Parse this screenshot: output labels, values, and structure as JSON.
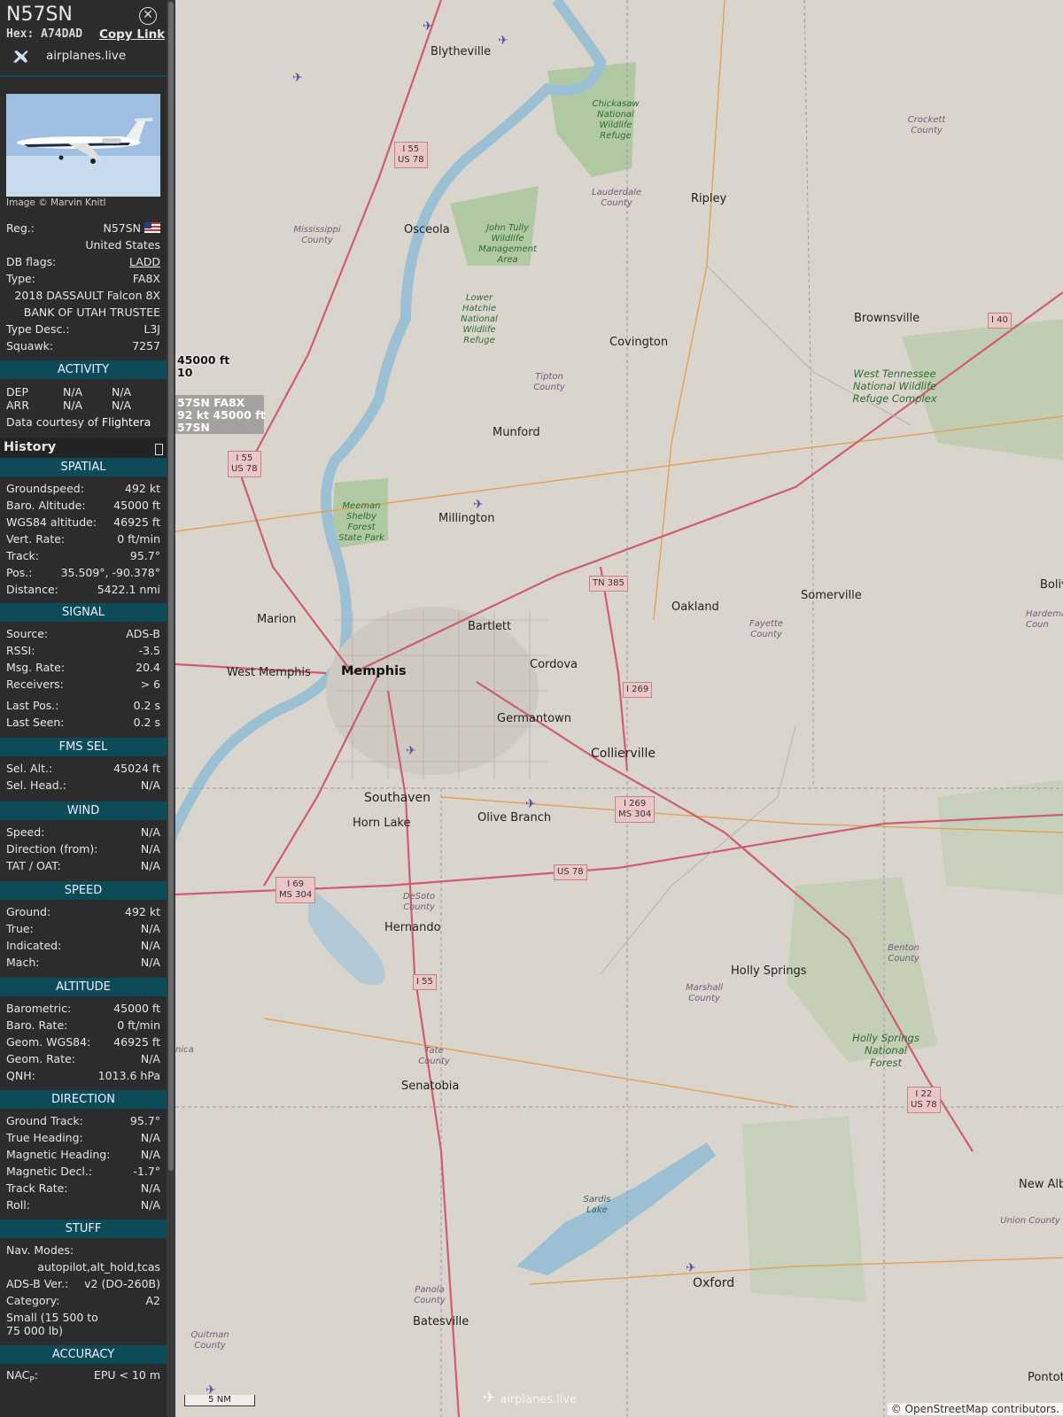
{
  "header": {
    "callsign": "N57SN",
    "hex_label": "Hex:",
    "hex": "A74DAD",
    "copy_link": "Copy Link",
    "link_text": "airplanes.live"
  },
  "photo": {
    "credit": "Image © Marvin Knitl"
  },
  "info": {
    "reg_label": "Reg.:",
    "reg": "N57SN",
    "country": "United States",
    "dbflags_label": "DB flags:",
    "dbflags": "LADD",
    "type_label": "Type:",
    "type": "FA8X",
    "model": "2018 DASSAULT Falcon 8X",
    "owner": "BANK OF UTAH TRUSTEE",
    "typedesc_label": "Type Desc.:",
    "typedesc": "L3J",
    "squawk_label": "Squawk:",
    "squawk": "7257"
  },
  "activity": {
    "title": "ACTIVITY",
    "dep": "DEP",
    "arr": "ARR",
    "na": "N/A",
    "courtesy": "Data courtesy of",
    "source": "Flightera"
  },
  "history": {
    "title": "History"
  },
  "spatial": {
    "title": "SPATIAL",
    "rows": [
      [
        "Groundspeed:",
        "492 kt"
      ],
      [
        "Baro. Altitude:",
        "45000 ft"
      ],
      [
        "WGS84 altitude:",
        "46925 ft"
      ],
      [
        "Vert. Rate:",
        "0 ft/min"
      ],
      [
        "Track:",
        "95.7°"
      ],
      [
        "Pos.:",
        "35.509°, -90.378°"
      ],
      [
        "Distance:",
        "5422.1 nmi"
      ]
    ]
  },
  "signal": {
    "title": "SIGNAL",
    "rows": [
      [
        "Source:",
        "ADS-B"
      ],
      [
        "RSSI:",
        "-3.5"
      ],
      [
        "Msg. Rate:",
        "20.4"
      ],
      [
        "Receivers:",
        "> 6"
      ],
      [
        "Last Pos.:",
        "0.2 s"
      ],
      [
        "Last Seen:",
        "0.2 s"
      ]
    ]
  },
  "fms": {
    "title": "FMS SEL",
    "rows": [
      [
        "Sel. Alt.:",
        "45024 ft"
      ],
      [
        "Sel. Head.:",
        "N/A"
      ]
    ]
  },
  "wind": {
    "title": "WIND",
    "rows": [
      [
        "Speed:",
        "N/A"
      ],
      [
        "Direction (from):",
        "N/A"
      ],
      [
        "TAT / OAT:",
        "N/A"
      ]
    ]
  },
  "speed": {
    "title": "SPEED",
    "rows": [
      [
        "Ground:",
        "492 kt"
      ],
      [
        "True:",
        "N/A"
      ],
      [
        "Indicated:",
        "N/A"
      ],
      [
        "Mach:",
        "N/A"
      ]
    ]
  },
  "altitude": {
    "title": "ALTITUDE",
    "rows": [
      [
        "Barometric:",
        "45000 ft"
      ],
      [
        "Baro. Rate:",
        "0 ft/min"
      ],
      [
        "Geom. WGS84:",
        "46925 ft"
      ],
      [
        "Geom. Rate:",
        "N/A"
      ],
      [
        "QNH:",
        "1013.6 hPa"
      ]
    ]
  },
  "direction": {
    "title": "DIRECTION",
    "rows": [
      [
        "Ground Track:",
        "95.7°"
      ],
      [
        "True Heading:",
        "N/A"
      ],
      [
        "Magnetic Heading:",
        "N/A"
      ],
      [
        "Magnetic Decl.:",
        "-1.7°"
      ],
      [
        "Track Rate:",
        "N/A"
      ],
      [
        "Roll:",
        "N/A"
      ]
    ]
  },
  "stuff": {
    "title": "STUFF",
    "navmodes_label": "Nav. Modes:",
    "navmodes": "autopilot,alt_hold,tcas",
    "adsb_label": "ADS-B Ver.:",
    "adsb": "v2 (DO-260B)",
    "cat_label": "Category:",
    "cat": "A2",
    "cat_desc1": "Small (15 500 to",
    "cat_desc2": "75 000 lb)"
  },
  "accuracy": {
    "title": "ACCURACY",
    "nacp_label": "NAC",
    "nacp_sub": "P",
    "nacp_colon": ":",
    "nacp": "EPU < 10 m"
  },
  "map": {
    "aircraft_label": {
      "alt": "45000 ft",
      "trk": "10",
      "line1": "57SN FA8X",
      "line2": "92 kt  45000 ft",
      "line3": "57SN"
    },
    "bigcities": [
      "Memphis"
    ],
    "cities": [
      "Blytheville",
      "Osceola",
      "Ripley",
      "Covington",
      "Brownsville",
      "Munford",
      "Millington",
      "Somerville",
      "Oakland",
      "Bartlett",
      "Cordova",
      "Marion",
      "West Memphis",
      "Germantown",
      "Collierville",
      "Southaven",
      "Horn Lake",
      "Olive Branch",
      "Hernando",
      "Holly Springs",
      "Senatobia",
      "Batesville",
      "Oxford",
      "New Albany",
      "Pontotoc",
      "Boliva"
    ],
    "counties": [
      "Crockett County",
      "Lauderdale County",
      "Mississippi County",
      "Tipton County",
      "Fayette County",
      "Marshall County",
      "Benton County",
      "Tate County",
      "DeSoto County",
      "Panola County",
      "Quitman County",
      "Union County",
      "Hardeman Coun",
      "nica"
    ],
    "parks": [
      "Chickasaw National Wildlife Refuge",
      "John Tully Wildlife Management Area",
      "Lower Hatchie National Wildlife Refuge",
      "Meeman Shelby Forest State Park",
      "West Tennessee National Wildlife Refuge Complex",
      "Holly Springs National Forest",
      "Sardis Lake"
    ],
    "shields": [
      "I 55\nUS 78",
      "I 55\nUS 78",
      "I 40",
      "TN 385",
      "I 269",
      "I 269\nMS 304",
      "I 69\nMS 304",
      "US 78",
      "I 55",
      "I 22\nUS 78"
    ],
    "scale": "5 NM",
    "attribution": "© OpenStreetMap contributors.",
    "watermark": "airplanes.live"
  }
}
